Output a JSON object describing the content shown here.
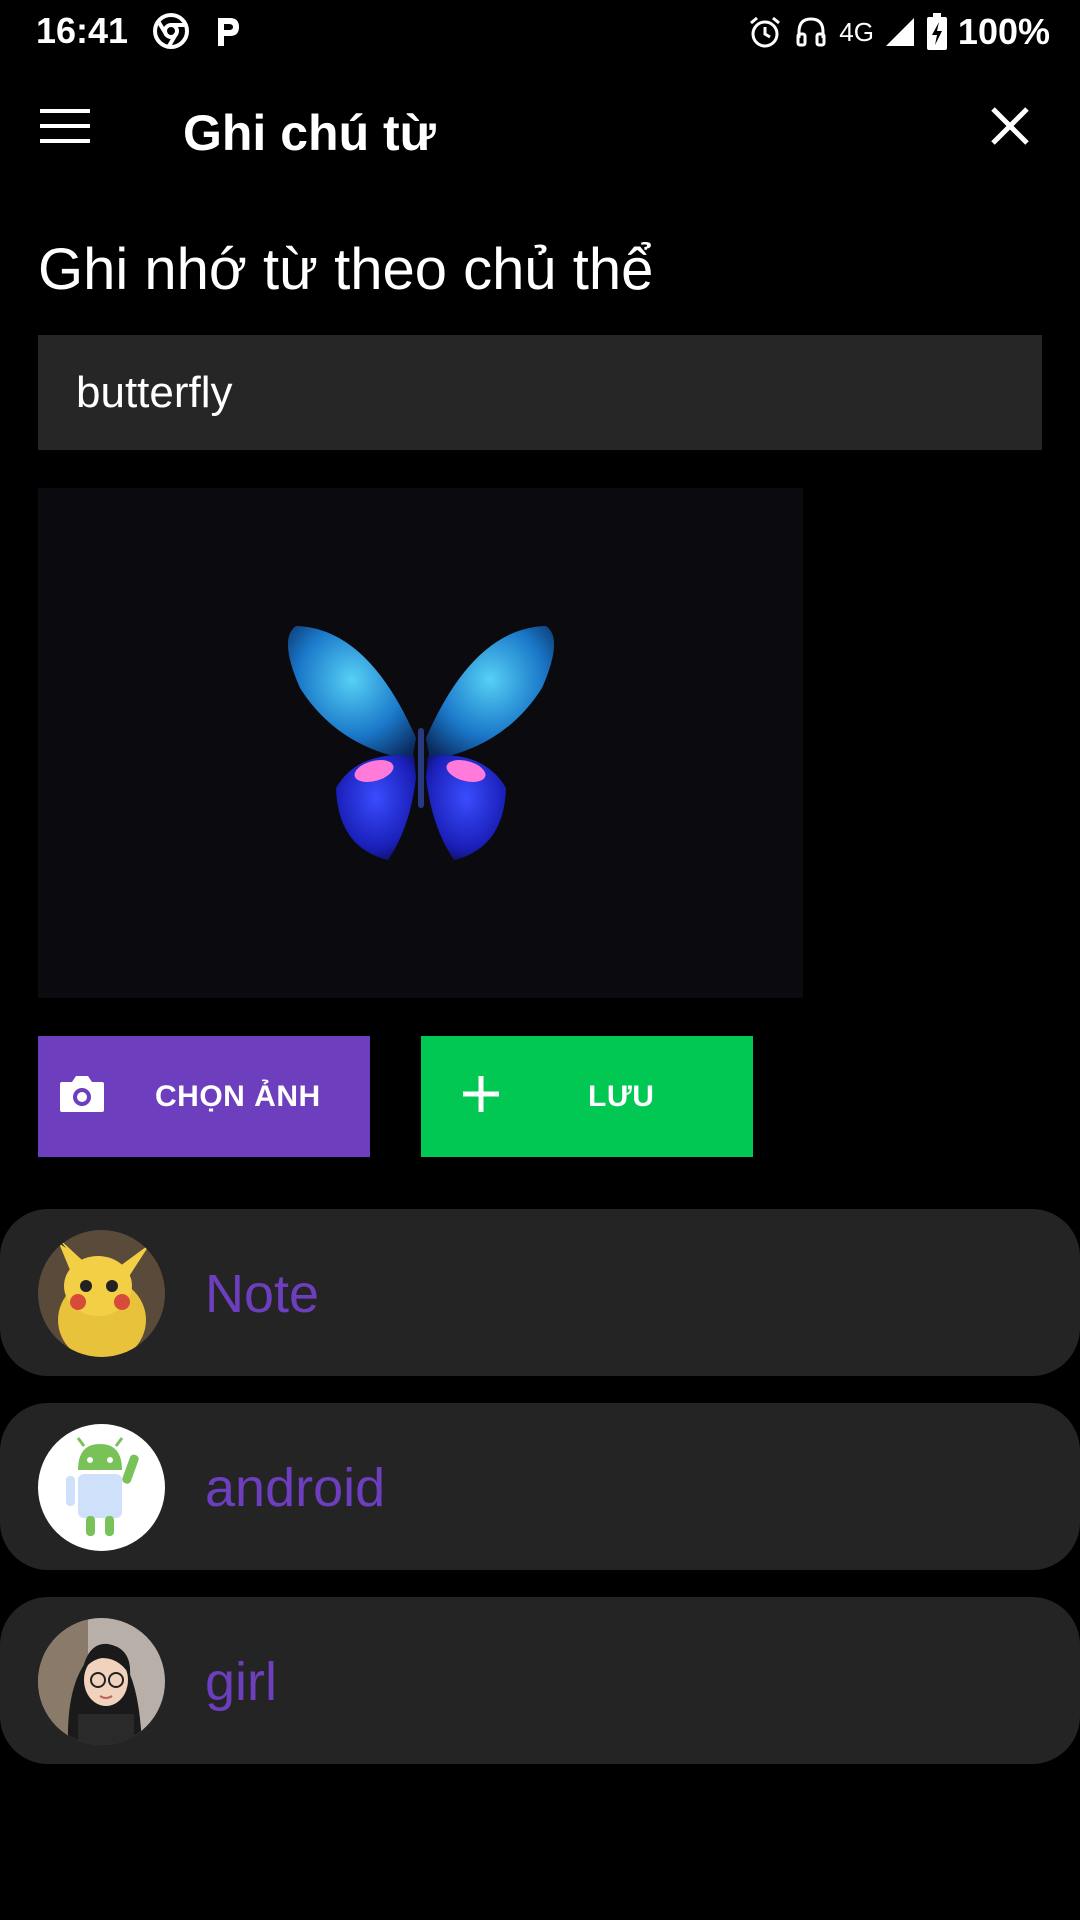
{
  "status_bar": {
    "time": "16:41",
    "left_icons": [
      "chrome-icon",
      "parking-icon"
    ],
    "right_icons": [
      "alarm-icon",
      "headset-icon",
      "signal-icon",
      "battery-charging-icon"
    ],
    "network": "4G",
    "battery": "100%"
  },
  "app_bar": {
    "title": "Ghi chú từ",
    "menu_icon": "hamburger-menu-icon",
    "close_icon": "close-icon"
  },
  "heading": "Ghi nhớ từ theo chủ thể",
  "word_input": {
    "value": "butterfly"
  },
  "preview": {
    "subject": "butterfly"
  },
  "buttons": {
    "choose_image": "CHỌN ẢNH",
    "save": "LƯU"
  },
  "colors": {
    "accent": "#6d3ebd",
    "save": "#00c853",
    "surface": "#242424",
    "background": "#000000"
  },
  "notes": [
    {
      "label": "Note",
      "avatar": "pikachu"
    },
    {
      "label": "android",
      "avatar": "android-robot"
    },
    {
      "label": "girl",
      "avatar": "girl-portrait"
    }
  ]
}
